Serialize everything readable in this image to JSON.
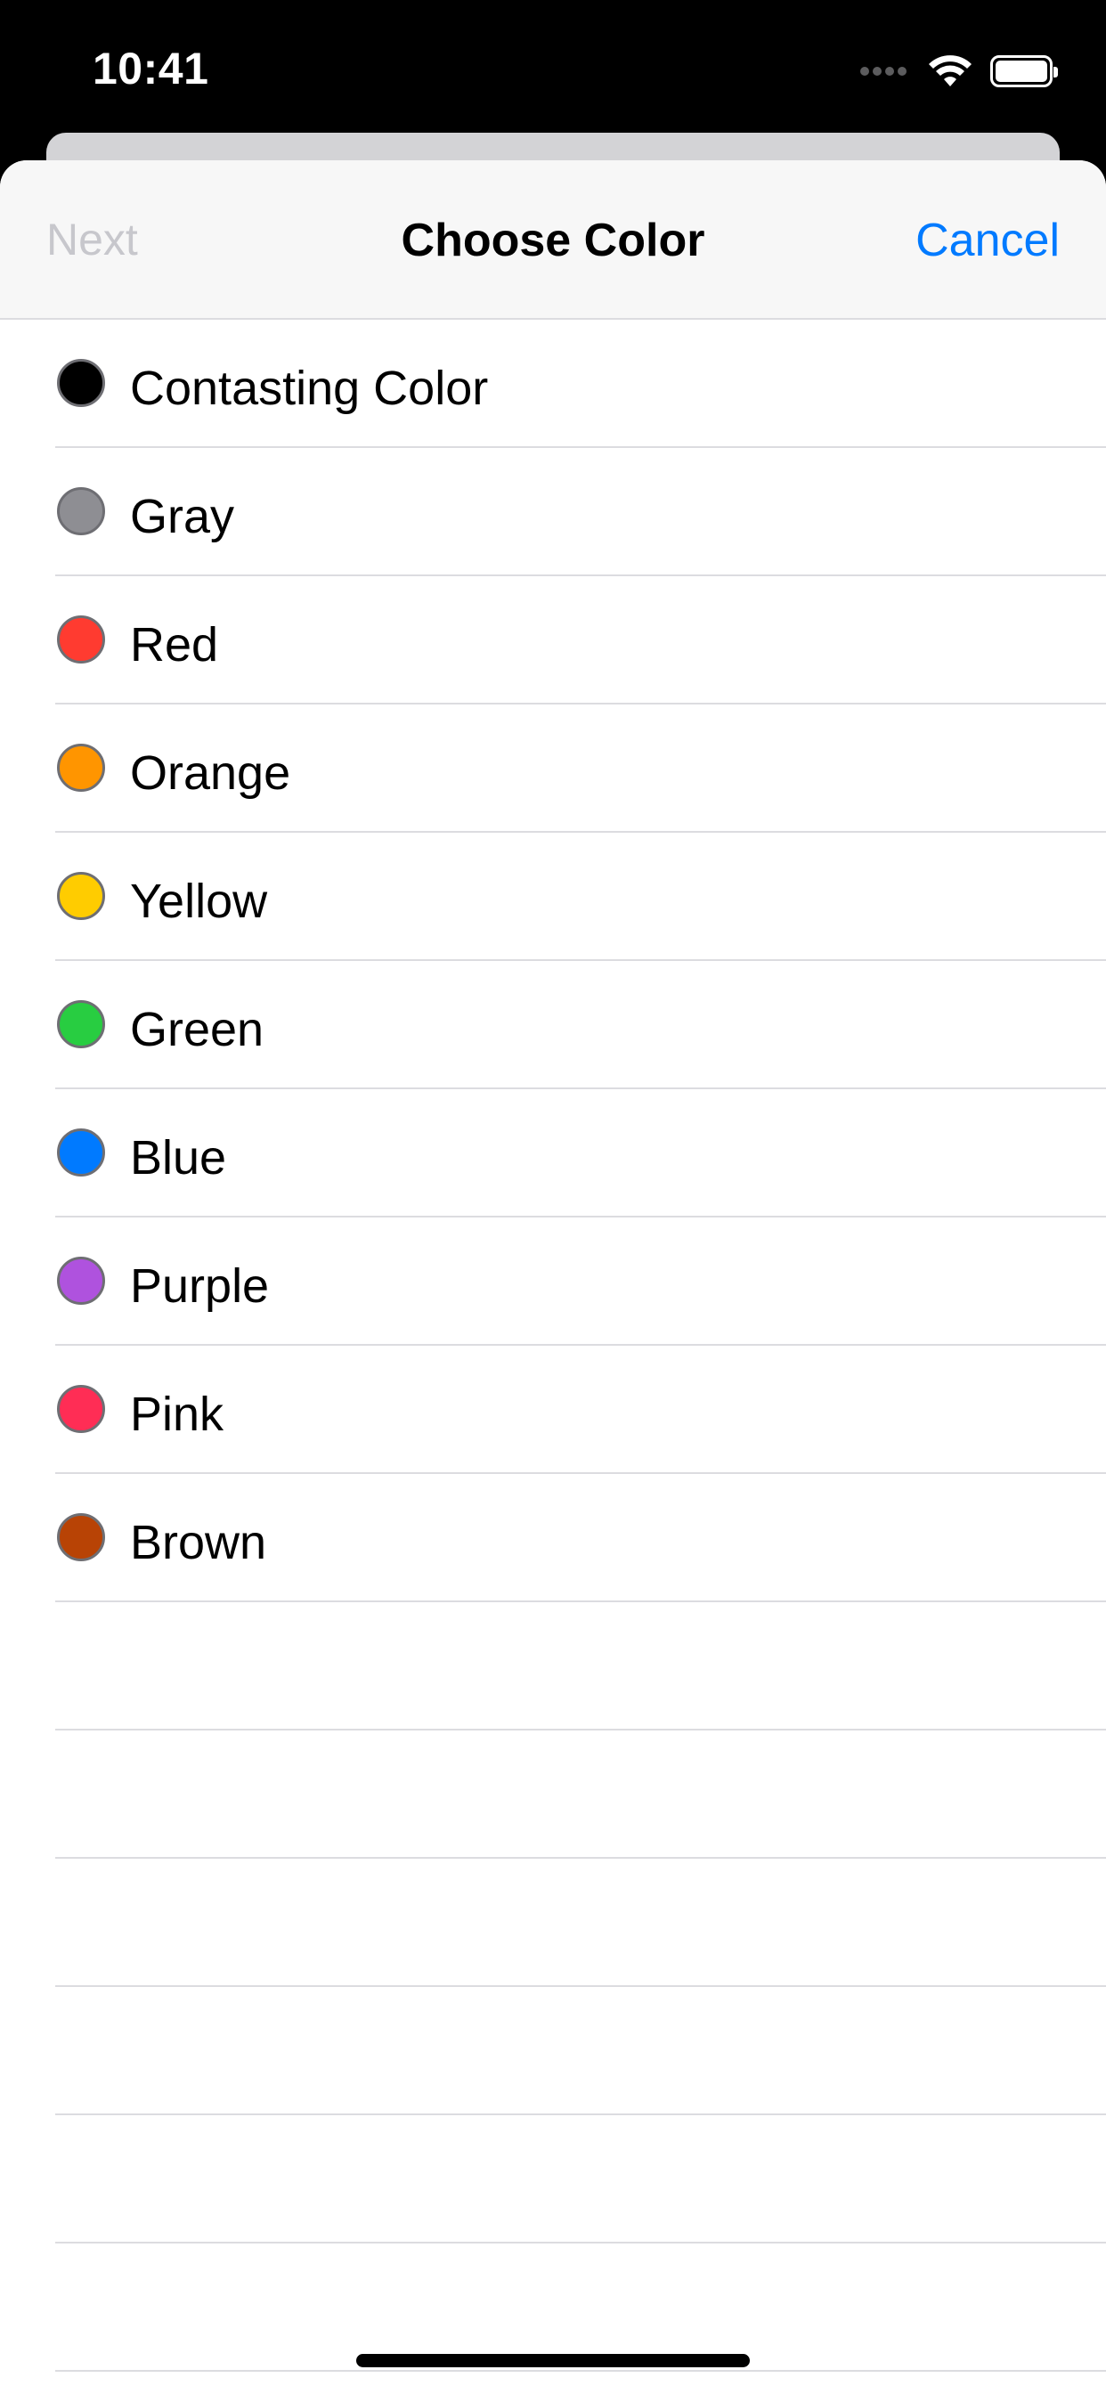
{
  "status_bar": {
    "time": "10:41",
    "icons": [
      "signal-dots-icon",
      "wifi-icon",
      "battery-icon"
    ]
  },
  "nav": {
    "next_label": "Next",
    "title": "Choose Color",
    "cancel_label": "Cancel",
    "accent_color": "#007aff",
    "disabled_color": "#c7c7cc"
  },
  "colors": [
    {
      "label": "Contasting Color",
      "swatch": "#000000"
    },
    {
      "label": "Gray",
      "swatch": "#8e8e93"
    },
    {
      "label": "Red",
      "swatch": "#ff3b30"
    },
    {
      "label": "Orange",
      "swatch": "#ff9500"
    },
    {
      "label": "Yellow",
      "swatch": "#ffcc00"
    },
    {
      "label": "Green",
      "swatch": "#28cd41"
    },
    {
      "label": "Blue",
      "swatch": "#007aff"
    },
    {
      "label": "Purple",
      "swatch": "#af52de"
    },
    {
      "label": "Pink",
      "swatch": "#ff2d55"
    },
    {
      "label": "Brown",
      "swatch": "#b84305"
    }
  ]
}
